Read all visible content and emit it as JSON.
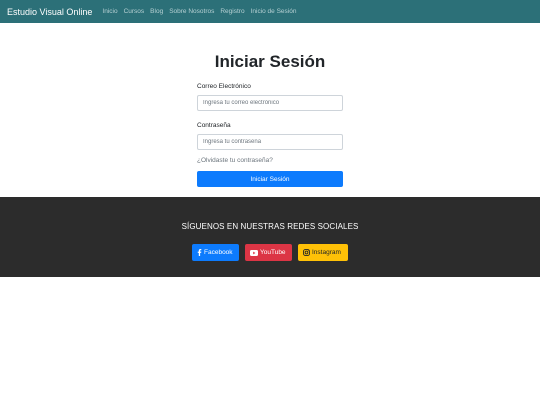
{
  "navbar": {
    "brand": "Estudio Visual Online",
    "links": [
      "Inicio",
      "Cursos",
      "Blog",
      "Sobre Nosotros",
      "Registro",
      "Inicio de Sesión"
    ]
  },
  "login": {
    "title": "Iniciar Sesión",
    "email_label": "Correo Electrónico",
    "email_placeholder": "Ingresa tu correo electrónico",
    "password_label": "Contraseña",
    "password_placeholder": "Ingresa tu contraseña",
    "forgot_link": "¿Olvidaste tu contraseña?",
    "submit_label": "Iniciar Sesión"
  },
  "footer": {
    "heading": "SÍGUENOS EN NUESTRAS REDES SOCIALES",
    "socials": [
      {
        "label": "Facebook",
        "icon": "facebook-icon",
        "color": "#0d7bfd"
      },
      {
        "label": "YouTube",
        "icon": "youtube-icon",
        "color": "#dc3545"
      },
      {
        "label": "Instagram",
        "icon": "instagram-icon",
        "color": "#ffc107"
      }
    ]
  },
  "colors": {
    "navbar_bg": "#2c7078",
    "footer_bg": "#2c2c2c",
    "primary": "#0d7bfd"
  }
}
